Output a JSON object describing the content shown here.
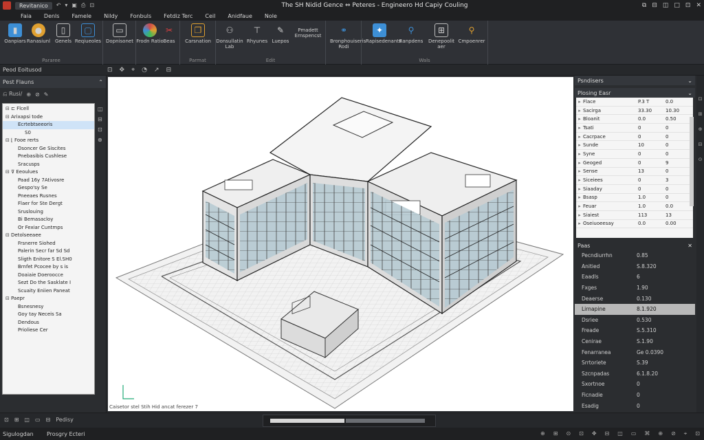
{
  "titlebar": {
    "file_tab": "Revitanico",
    "title": "The SH Nidid Gence ⇔ Peteres - Engineero Hd Capiy Couling",
    "window_controls": [
      "⧉",
      "⊟",
      "◫",
      "□",
      "⊡",
      "✕"
    ]
  },
  "menu": [
    "Faia",
    "Denls",
    "Famele",
    "Nildy",
    "Fonbuls",
    "Fetdiz Terc",
    "Ceil",
    "Anidfaue",
    "Nole"
  ],
  "ribbon": {
    "groups": [
      {
        "label": "Pararee",
        "buttons": [
          {
            "label": "Oanpiars",
            "icon": "folder-icon",
            "color": "#3d8fd6"
          },
          {
            "label": "Ranasiunl",
            "icon": "globe-icon",
            "color": "#e0a030"
          },
          {
            "label": "Genels",
            "icon": "document-icon",
            "color": "#bbbbbb"
          },
          {
            "label": "Reqiueoles",
            "icon": "page-icon",
            "color": "#3d8fd6"
          }
        ]
      },
      {
        "label": "",
        "buttons": [
          {
            "label": "Dopnisonet",
            "icon": "monitor-icon",
            "color": "#bbbbbb"
          }
        ]
      },
      {
        "label": "",
        "buttons": [
          {
            "label": "Frodn Ratio",
            "icon": "color-wheel-icon",
            "color": "#d04a4a"
          },
          {
            "label": "Beas",
            "icon": "scissors-icon",
            "color": "#e04040"
          }
        ]
      },
      {
        "label": "Parmat",
        "buttons": [
          {
            "label": "Carsnation",
            "icon": "copy-icon",
            "color": "#e0a030"
          }
        ]
      },
      {
        "label": "Edit",
        "buttons": [
          {
            "label": "Donsullatin Lab",
            "icon": "users-icon",
            "color": "#bbbbbb"
          },
          {
            "label": "Rhyunes",
            "icon": "stamp-icon",
            "color": "#bbbbbb"
          },
          {
            "label": "Luepos",
            "icon": "pencil-icon",
            "color": "#bbbbbb"
          },
          {
            "label": "Pmadett Ernspencst",
            "icon": "text-icon",
            "color": "#bbbbbb"
          }
        ]
      },
      {
        "label": "",
        "buttons": [
          {
            "label": "Bronphouiseris Rodi",
            "icon": "binoculars-icon",
            "color": "#3d8fd6"
          }
        ]
      },
      {
        "label": "Wals",
        "buttons": [
          {
            "label": "Rapisedenants",
            "icon": "star-icon",
            "color": "#3d8fd6"
          },
          {
            "label": "Ranpdens",
            "icon": "share-icon",
            "color": "#3d8fd6"
          },
          {
            "label": "Denepoolit aer",
            "icon": "grid-icon",
            "color": "#bbbbbb"
          },
          {
            "label": "Cmpoenrer",
            "icon": "magnifier-icon",
            "color": "#e0a030"
          }
        ]
      }
    ]
  },
  "subtool": {
    "panel_title": "Peod Eoitusod",
    "tools": [
      "⊡",
      "✥",
      "⌖",
      "◔",
      "↗",
      "⊟"
    ]
  },
  "browser": {
    "title": "Pest Flauns",
    "tools": [
      "⎌ Rusi/",
      "⊕",
      "⊘",
      "✎"
    ],
    "tree": [
      {
        "tog": "⊟",
        "indent": 0,
        "text": "⊏ Flcell"
      },
      {
        "tog": "⊟",
        "indent": 0,
        "text": "Arixapsi tode"
      },
      {
        "tog": "",
        "indent": 1,
        "text": "Ecrtebtseeoris",
        "sel": true
      },
      {
        "tog": "",
        "indent": 2,
        "text": "S0"
      },
      {
        "tog": "⊟",
        "indent": 0,
        "text": "⌊ Fooe rerts"
      },
      {
        "tog": "",
        "indent": 1,
        "text": "Dsoncer Ge Siscites"
      },
      {
        "tog": "",
        "indent": 1,
        "text": "Pnebasibis Cushlese"
      },
      {
        "tog": "",
        "indent": 1,
        "text": "Sracusps"
      },
      {
        "tog": "⊟",
        "indent": 0,
        "text": "⊽ Eeoulues"
      },
      {
        "tog": "",
        "indent": 1,
        "text": "Paad 16y 7Ativosre"
      },
      {
        "tog": "",
        "indent": 1,
        "text": "Gespo'sy Se"
      },
      {
        "tog": "",
        "indent": 1,
        "text": "Pneeaes Rusnes"
      },
      {
        "tog": "",
        "indent": 1,
        "text": "Flaer for Ste Dergt"
      },
      {
        "tog": "",
        "indent": 1,
        "text": "Sruslouing"
      },
      {
        "tog": "",
        "indent": 1,
        "text": "Bi Bemasacloy"
      },
      {
        "tog": "",
        "indent": 1,
        "text": "Or Fexiar Cuntmps"
      },
      {
        "tog": "⊟",
        "indent": 0,
        "text": "Detolseeaee"
      },
      {
        "tog": "",
        "indent": 1,
        "text": "Frsnerre Siohed"
      },
      {
        "tog": "",
        "indent": 1,
        "text": "Palerin Secr far Sd Sd"
      },
      {
        "tog": "",
        "indent": 1,
        "text": "Sligth Enitore S El.SH0"
      },
      {
        "tog": "",
        "indent": 1,
        "text": "Brnfet Pcocee by s is"
      },
      {
        "tog": "",
        "indent": 1,
        "text": "Doaiaie Doeroocce"
      },
      {
        "tog": "",
        "indent": 1,
        "text": "Sezt Do the Sasklate I"
      },
      {
        "tog": "",
        "indent": 1,
        "text": "Scuaity Eniien Paneat"
      },
      {
        "tog": "⊟",
        "indent": 0,
        "text": "Paepr"
      },
      {
        "tog": "",
        "indent": 1,
        "text": "Bsnesnesy"
      },
      {
        "tog": "",
        "indent": 1,
        "text": "Goy tay Neceis Sa"
      },
      {
        "tog": "",
        "indent": 1,
        "text": "Dendous"
      },
      {
        "tog": "",
        "indent": 1,
        "text": "Prioliese Cer"
      }
    ],
    "bottom_tools": [
      "⊡",
      "⊞",
      "◫",
      "▭",
      "⊟",
      "Pedisy"
    ]
  },
  "viewport": {
    "command_text": "Caisetor stel Stih Hid ancat ferezer 7"
  },
  "properties": {
    "title": "Psndisers",
    "subtitle": "Plosing Easr",
    "rows": [
      {
        "name": "Flace",
        "a": "P.3 T",
        "b": "0.0"
      },
      {
        "name": "Sacirga",
        "a": "33.30",
        "b": "10.30"
      },
      {
        "name": "Bloanit",
        "a": "0.0",
        "b": "0.50"
      },
      {
        "name": "Tsati",
        "a": "0",
        "b": "0"
      },
      {
        "name": "Cacrpace",
        "a": "0",
        "b": "0"
      },
      {
        "name": "Sunde",
        "a": "10",
        "b": "0"
      },
      {
        "name": "Syne",
        "a": "0",
        "b": "0"
      },
      {
        "name": "Geoged",
        "a": "0",
        "b": "9"
      },
      {
        "name": "Sense",
        "a": "13",
        "b": "0"
      },
      {
        "name": "Siceiees",
        "a": "0",
        "b": "3"
      },
      {
        "name": "Siaaday",
        "a": "0",
        "b": "0"
      },
      {
        "name": "Bsasp",
        "a": "1.0",
        "b": "0"
      },
      {
        "name": "Feuar",
        "a": "1.0",
        "b": "0.0"
      },
      {
        "name": "Siaiest",
        "a": "113",
        "b": "13"
      },
      {
        "name": "Oseiuoeesay",
        "a": "0.0",
        "b": "0.00"
      }
    ]
  },
  "params": {
    "title": "Paas",
    "rows": [
      {
        "k": "Pecndiurrhn",
        "v": "0.85"
      },
      {
        "k": "Anitied",
        "v": "S.8.320"
      },
      {
        "k": "Eaadls",
        "v": "6"
      },
      {
        "k": "Fxges",
        "v": "1.90"
      },
      {
        "k": "Deaerse",
        "v": "0.130"
      },
      {
        "k": "Lirnapine",
        "v": "8.1.920",
        "sel": true
      },
      {
        "k": "Dsriee",
        "v": "0.530"
      },
      {
        "k": "Freade",
        "v": "S.5.310"
      },
      {
        "k": "Cenirae",
        "v": "S.1.90"
      },
      {
        "k": "Fenarranea",
        "v": "Ge 0.0390"
      },
      {
        "k": "Srrtoriete",
        "v": "S.39"
      },
      {
        "k": "Szcnpadas",
        "v": "6.1.8.20"
      },
      {
        "k": "Sxortnoe",
        "v": "0"
      },
      {
        "k": "Ficnadie",
        "v": "0"
      },
      {
        "k": "Esadig",
        "v": "0"
      }
    ]
  },
  "viewbar": {
    "progress": 0.36
  },
  "status": {
    "left": "Sigulogdan",
    "middle": "Prosgry Ecteri",
    "icons": [
      "⊕",
      "⊞",
      "⊙",
      "⊡",
      "✥",
      "⊟",
      "◫",
      "▭",
      "⌘",
      "⊕",
      "⊘",
      "⌖",
      "⊡"
    ]
  },
  "colors": {
    "accent": "#3d8fd6",
    "glass": "#b7cbd3"
  }
}
